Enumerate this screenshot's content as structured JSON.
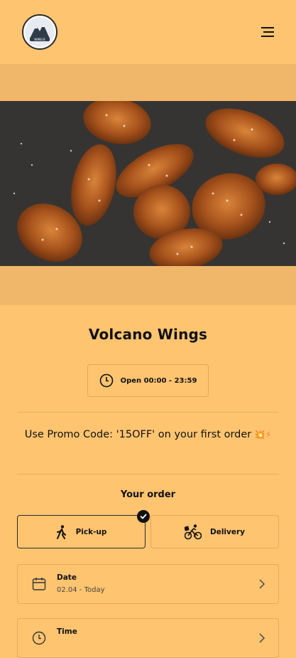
{
  "header": {
    "logo_text": "WINGS",
    "menu_icon": "hamburger-menu-icon"
  },
  "restaurant": {
    "name": "Volcano Wings",
    "hours": "Open 00:00 - 23:59",
    "hours_icon": "clock-icon"
  },
  "promo": {
    "text": "Use Promo Code: '15OFF' on your first order",
    "emoji": "💥⚡"
  },
  "order": {
    "heading": "Your order",
    "options": [
      {
        "label": "Pick-up",
        "icon": "walking-person-icon",
        "selected": true
      },
      {
        "label": "Delivery",
        "icon": "cyclist-icon",
        "selected": false
      }
    ],
    "date": {
      "label": "Date",
      "value": "02.04 - Today",
      "icon": "calendar-icon"
    },
    "time": {
      "label": "Time",
      "value": "",
      "icon": "clock-icon"
    }
  },
  "colors": {
    "background": "#FFC470",
    "band": "#F0B76A",
    "border": "#E2A95E",
    "text": "#111111"
  }
}
